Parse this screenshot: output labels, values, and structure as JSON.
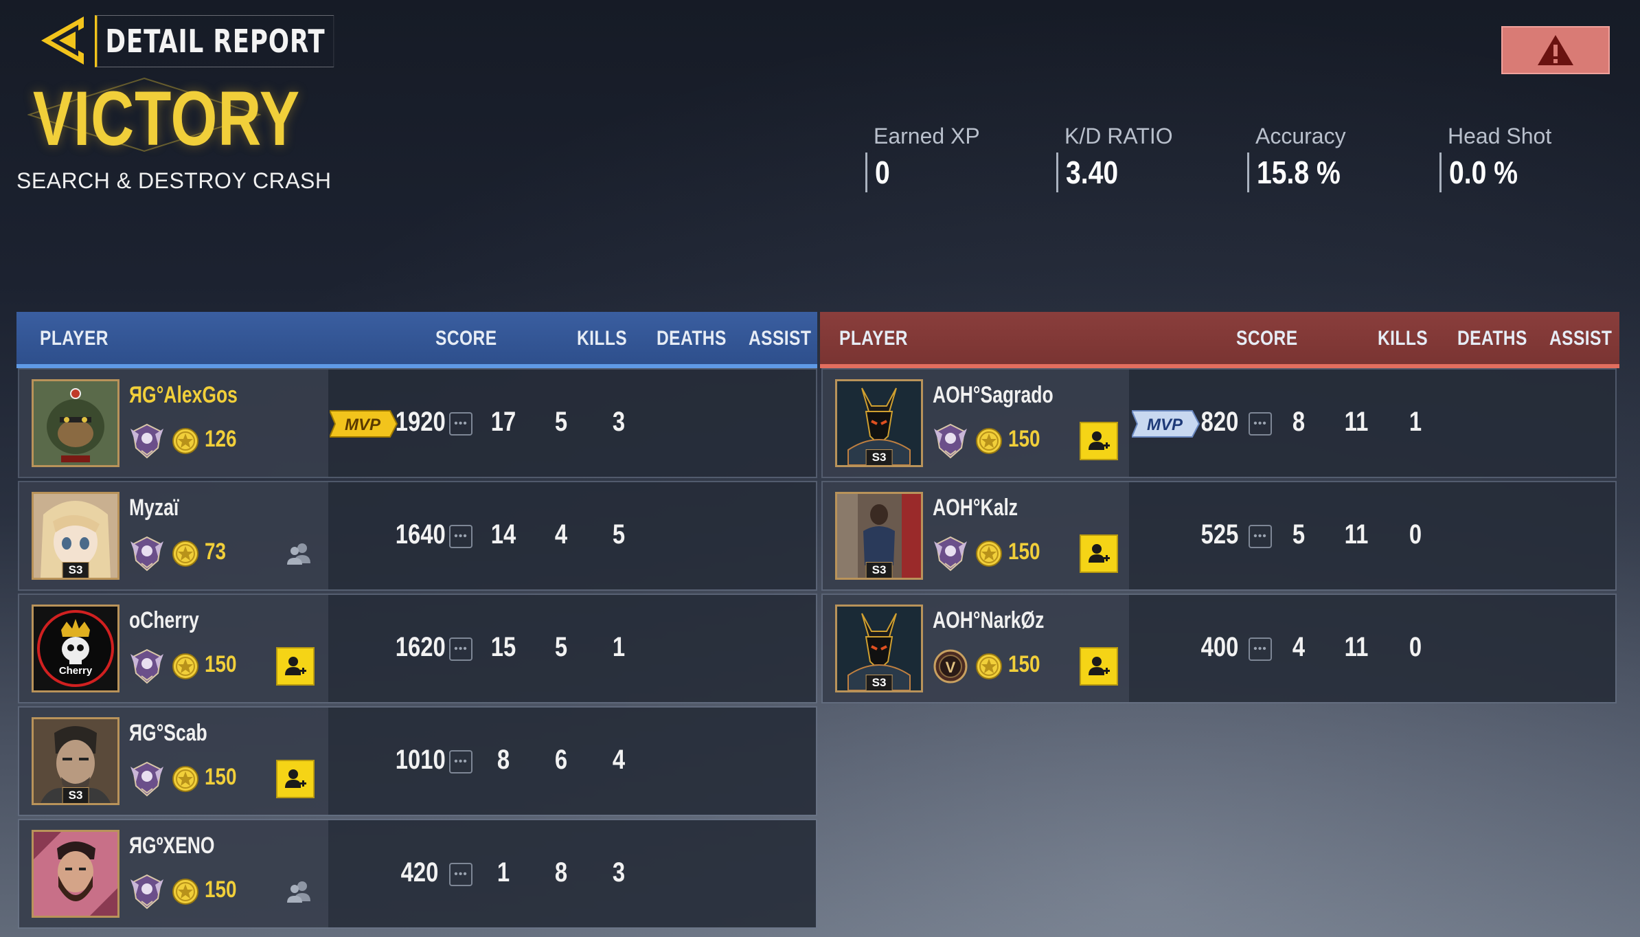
{
  "header": {
    "title": "DETAIL REPORT",
    "result": "VICTORY",
    "mode": "SEARCH & DESTROY CRASH"
  },
  "stats": [
    {
      "label": "Earned XP",
      "value": "0"
    },
    {
      "label": "K/D RATIO",
      "value": "3.40"
    },
    {
      "label": "Accuracy",
      "value": "15.8 %"
    },
    {
      "label": "Head Shot",
      "value": "0.0 %"
    }
  ],
  "columns": {
    "player": "PLAYER",
    "score": "SCORE",
    "kills": "KILLS",
    "deaths": "DEATHS",
    "assist": "ASSIST"
  },
  "mvp_label": "MVP",
  "blue_team": [
    {
      "name": "ЯG°AlexGos",
      "level": "126",
      "score": "1920",
      "kills": "17",
      "deaths": "5",
      "assist": "3",
      "mvp": true,
      "action": "none",
      "avatar": "gorilla-avatar"
    },
    {
      "name": "Myzaï",
      "level": "73",
      "score": "1640",
      "kills": "14",
      "deaths": "4",
      "assist": "5",
      "mvp": false,
      "action": "party",
      "avatar": "anime-avatar",
      "badge": "S3"
    },
    {
      "name": "oCherry",
      "level": "150",
      "score": "1620",
      "kills": "15",
      "deaths": "5",
      "assist": "1",
      "mvp": false,
      "action": "add",
      "avatar": "skull-crown-avatar",
      "avatar_text": "Cherry"
    },
    {
      "name": "ЯG°Scab",
      "level": "150",
      "score": "1010",
      "kills": "8",
      "deaths": "6",
      "assist": "4",
      "mvp": false,
      "action": "add",
      "avatar": "soldier-avatar",
      "badge": "S3"
    },
    {
      "name": "ЯGºXENO",
      "level": "150",
      "score": "420",
      "kills": "1",
      "deaths": "8",
      "assist": "3",
      "mvp": false,
      "action": "party",
      "avatar": "bearded-avatar"
    }
  ],
  "red_team": [
    {
      "name": "AOH°Sagrado",
      "level": "150",
      "score": "820",
      "kills": "8",
      "deaths": "11",
      "assist": "1",
      "mvp": true,
      "action": "add",
      "avatar": "anubis-avatar",
      "badge": "S3"
    },
    {
      "name": "AOH°Kalz",
      "level": "150",
      "score": "525",
      "kills": "5",
      "deaths": "11",
      "assist": "0",
      "mvp": false,
      "action": "add",
      "avatar": "person-avatar",
      "badge": "S3"
    },
    {
      "name": "AOH°NarkØz",
      "level": "150",
      "score": "400",
      "kills": "4",
      "deaths": "11",
      "assist": "0",
      "mvp": false,
      "action": "add",
      "avatar": "anubis-avatar",
      "badge": "S3",
      "emblem": "V"
    }
  ],
  "colors": {
    "gold": "#f1cf3a",
    "blue_team": "#2e4f8c",
    "red_team": "#7a3432",
    "report": "#d97b75",
    "add_friend": "#f5d416"
  }
}
